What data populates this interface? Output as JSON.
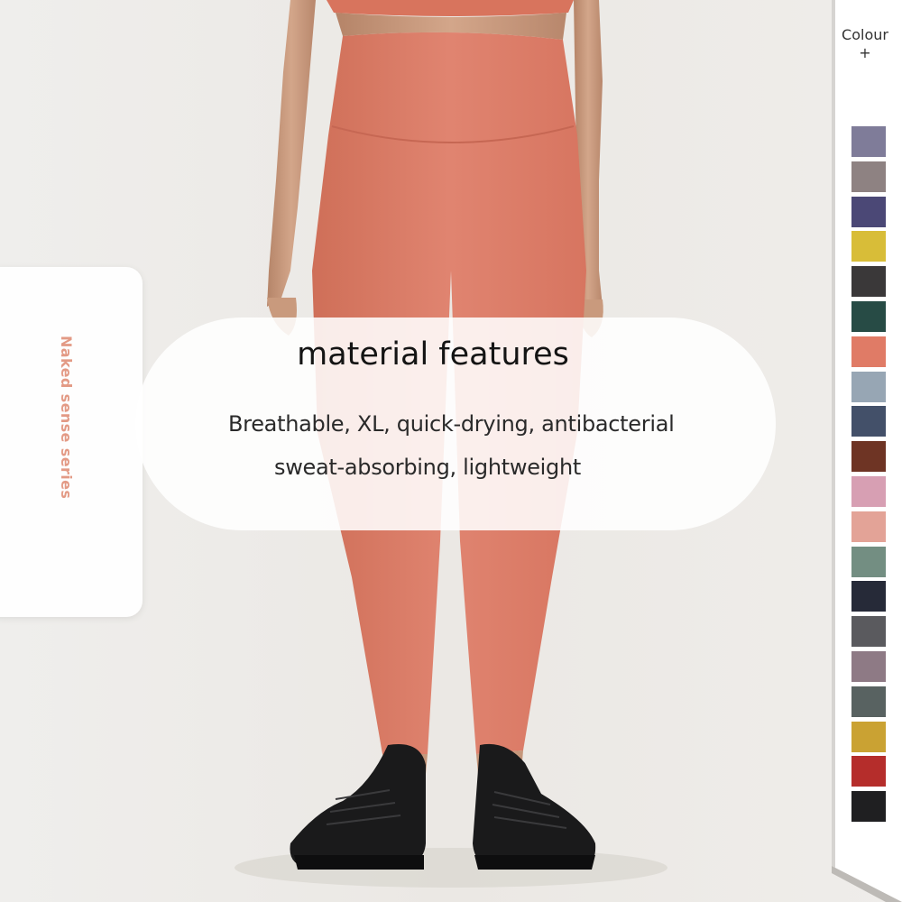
{
  "side_label": "Naked sense series",
  "features": {
    "title": "material features",
    "line1": "Breathable, XL, quick-drying, antibacterial",
    "line2": "sweat-absorbing, lightweight"
  },
  "colour_panel": {
    "label": "Colour",
    "plus": "+",
    "swatches": [
      "#7f7c99",
      "#8e8282",
      "#4b4876",
      "#d8bd38",
      "#3a3839",
      "#274b45",
      "#e07b66",
      "#97a6b4",
      "#435069",
      "#6e3424",
      "#d79fb3",
      "#e3a397",
      "#738e82",
      "#262a38",
      "#5a5a5e",
      "#8e7a85",
      "#586261",
      "#caa233",
      "#b52d2b",
      "#1f1f21"
    ]
  },
  "colors": {
    "background": "#efedea",
    "leggings": "#de8068",
    "accent_text": "#e39a85"
  }
}
